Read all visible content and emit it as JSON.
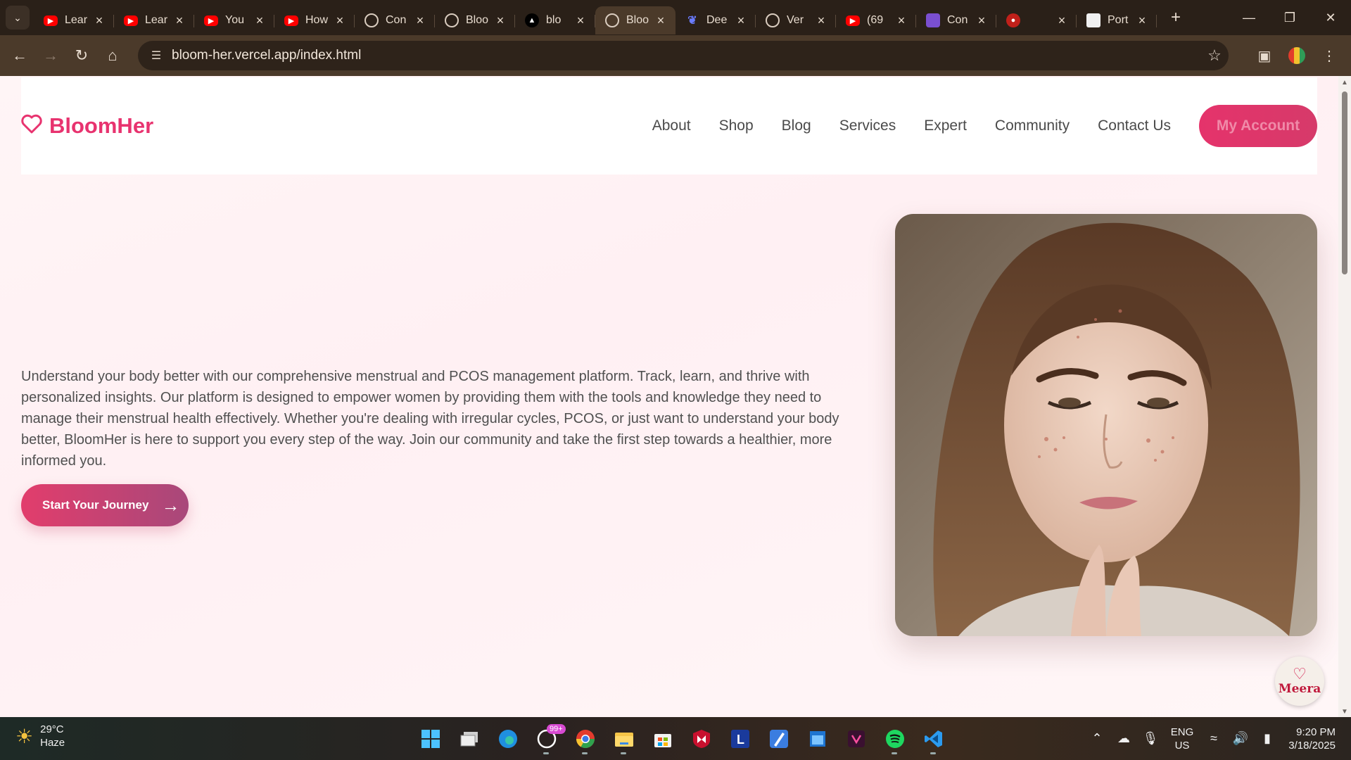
{
  "browser": {
    "tabs": [
      {
        "label": "Lear",
        "icon": "youtube-icon",
        "fav": "yt"
      },
      {
        "label": "Lear",
        "icon": "youtube-icon",
        "fav": "yt"
      },
      {
        "label": "You",
        "icon": "youtube-icon",
        "fav": "yt"
      },
      {
        "label": "How",
        "icon": "youtube-icon",
        "fav": "yt"
      },
      {
        "label": "Con",
        "icon": "openai-icon",
        "fav": "globe"
      },
      {
        "label": "Bloo",
        "icon": "globe-icon",
        "fav": "globe"
      },
      {
        "label": "blo",
        "icon": "vercel-icon",
        "fav": "tri"
      },
      {
        "label": "Bloo",
        "icon": "globe-icon",
        "fav": "globe",
        "active": true
      },
      {
        "label": "Dee",
        "icon": "deepseek-icon",
        "fav": "dee"
      },
      {
        "label": "Ver",
        "icon": "openai-icon",
        "fav": "globe"
      },
      {
        "label": "(69",
        "icon": "youtube-icon",
        "fav": "yt"
      },
      {
        "label": "Con",
        "icon": "app-icon",
        "fav": "purple"
      },
      {
        "label": "",
        "icon": "record-icon",
        "fav": "red"
      },
      {
        "label": "Port",
        "icon": "page-icon",
        "fav": "white"
      }
    ],
    "url": "bloom-her.vercel.app/index.html"
  },
  "site": {
    "brand": "BloomHer",
    "nav": {
      "about": "About",
      "shop": "Shop",
      "blog": "Blog",
      "services": "Services",
      "expert": "Expert",
      "community": "Community",
      "contact": "Contact Us",
      "account": "My Account"
    },
    "hero": {
      "description": "Understand your body better with our comprehensive menstrual and PCOS management platform. Track, learn, and thrive with personalized insights. Our platform is designed to empower women by providing them with the tools and knowledge they need to manage their menstrual health effectively. Whether you're dealing with irregular cycles, PCOS, or just want to understand your body better, BloomHer is here to support you every step of the way. Join our community and take the first step towards a healthier, more informed you.",
      "cta": "Start Your Journey"
    },
    "chat_widget": "Meera"
  },
  "taskbar": {
    "temperature": "29°C",
    "condition": "Haze",
    "whatsapp_badge": "99+",
    "lang_top": "ENG",
    "lang_bottom": "US",
    "time": "9:20 PM",
    "date": "3/18/2025"
  },
  "colors": {
    "accent": "#e8336f",
    "cta_start": "#e23d6c",
    "cta_end": "#a8487a"
  }
}
